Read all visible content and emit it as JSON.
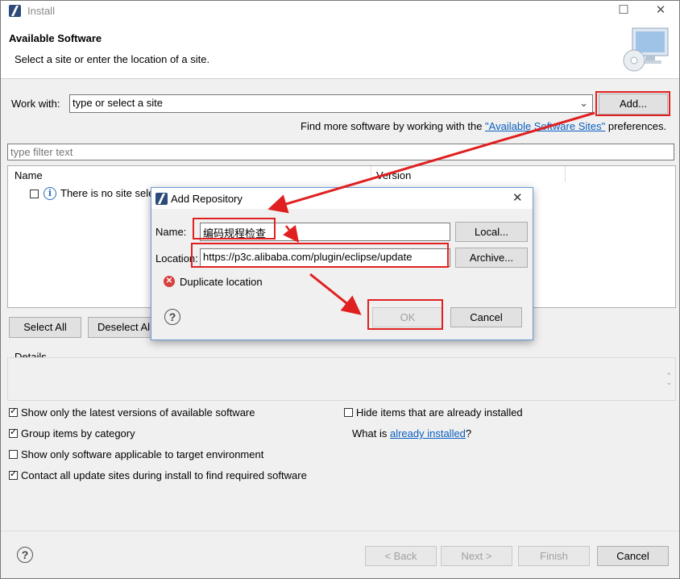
{
  "window": {
    "title": "Install"
  },
  "header": {
    "title": "Available Software",
    "subtitle": "Select a site or enter the location of a site."
  },
  "work_with": {
    "label": "Work with:",
    "value": "type or select a site",
    "add_label": "Add..."
  },
  "find_more": {
    "prefix": "Find more software by working with the ",
    "link": "\"Available Software Sites\"",
    "suffix": " preferences."
  },
  "filter": {
    "placeholder": "type filter text"
  },
  "table": {
    "col_name": "Name",
    "col_version": "Version",
    "empty_text": "There is no site selected."
  },
  "buttons": {
    "select_all": "Select All",
    "deselect_all": "Deselect All"
  },
  "details": {
    "label": "Details"
  },
  "options": {
    "latest": "Show only the latest versions of available software",
    "group": "Group items by category",
    "applicable": "Show only software applicable to target environment",
    "contact": "Contact all update sites during install to find required software",
    "hide_installed": "Hide items that are already installed",
    "what_is_prefix": "What is ",
    "what_is_link": "already installed",
    "what_is_suffix": "?"
  },
  "footer": {
    "back": "< Back",
    "next": "Next >",
    "finish": "Finish",
    "cancel": "Cancel"
  },
  "dialog": {
    "title": "Add Repository",
    "name_label": "Name:",
    "name_value": "编码规程检查",
    "location_label": "Location:",
    "location_value": "https://p3c.alibaba.com/plugin/eclipse/update",
    "local_label": "Local...",
    "archive_label": "Archive...",
    "error": "Duplicate location",
    "ok": "OK",
    "cancel": "Cancel"
  },
  "colors": {
    "annotation_red": "#e02020",
    "link_blue": "#0b5ebf"
  }
}
